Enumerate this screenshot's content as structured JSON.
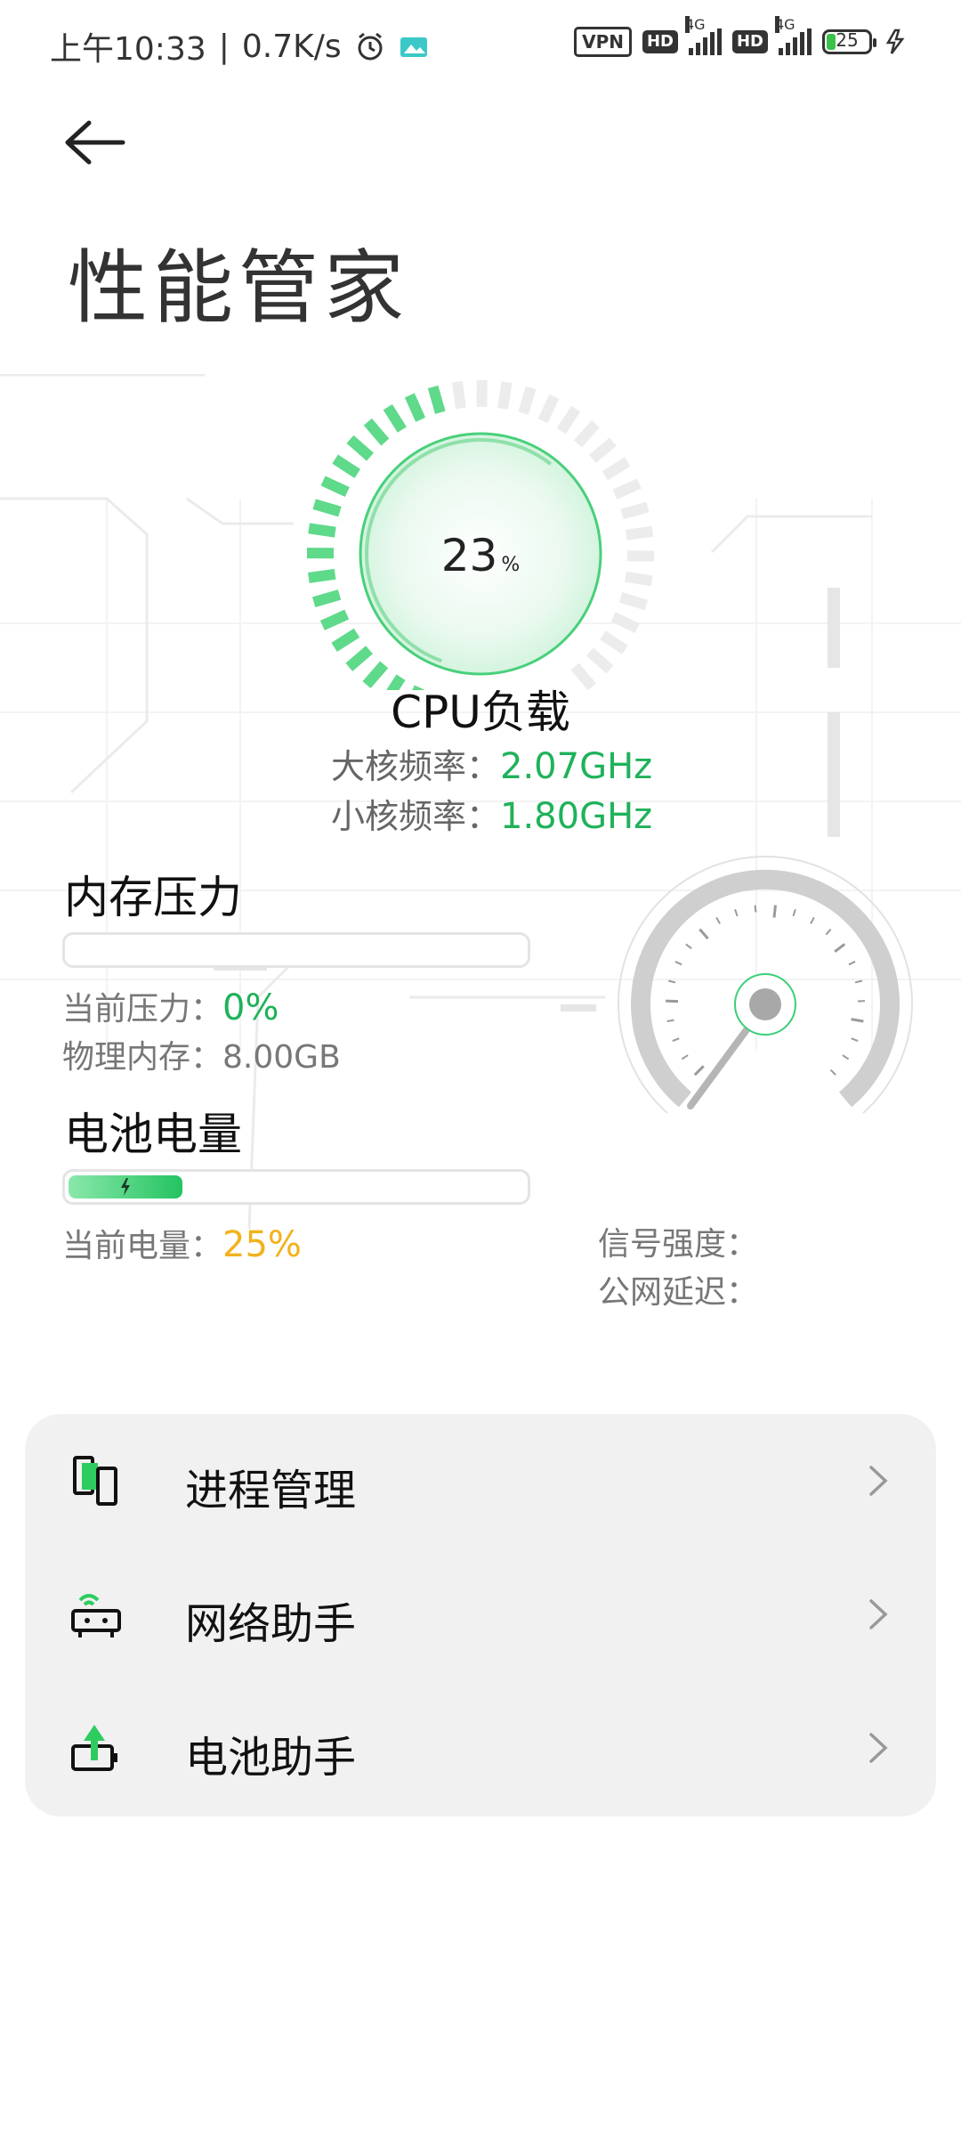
{
  "status_bar": {
    "time": "上午10:33",
    "speed": "0.7K/s",
    "vpn": "VPN",
    "hd1": "HD",
    "net1": "4G",
    "hd2": "HD",
    "net2": "4G",
    "battery": "25"
  },
  "header": {
    "title": "性能管家"
  },
  "cpu": {
    "value": "23",
    "unit": "%",
    "load_fraction": 0.23,
    "label": "CPU负载",
    "big_core_label": "大核频率：",
    "big_core_value": "2.07GHz",
    "small_core_label": "小核频率：",
    "small_core_value": "1.80GHz"
  },
  "memory": {
    "title": "内存压力",
    "pressure_fraction": 0,
    "pressure_label": "当前压力：",
    "pressure_value": "0%",
    "physical_label": "物理内存：",
    "physical_value": "8.00GB"
  },
  "battery": {
    "title": "电池电量",
    "level_fraction": 0.25,
    "level_label": "当前电量：",
    "level_value": "25%"
  },
  "network": {
    "signal_label": "信号强度：",
    "latency_label": "公网延迟："
  },
  "menu": {
    "items": [
      {
        "label": "进程管理",
        "icon": "process-icon"
      },
      {
        "label": "网络助手",
        "icon": "router-icon"
      },
      {
        "label": "电池助手",
        "icon": "battery-charge-icon"
      }
    ]
  },
  "colors": {
    "accent_green": "#1fb25a",
    "warning_yellow": "#f2b21c",
    "card_bg": "#f1f1f1"
  }
}
